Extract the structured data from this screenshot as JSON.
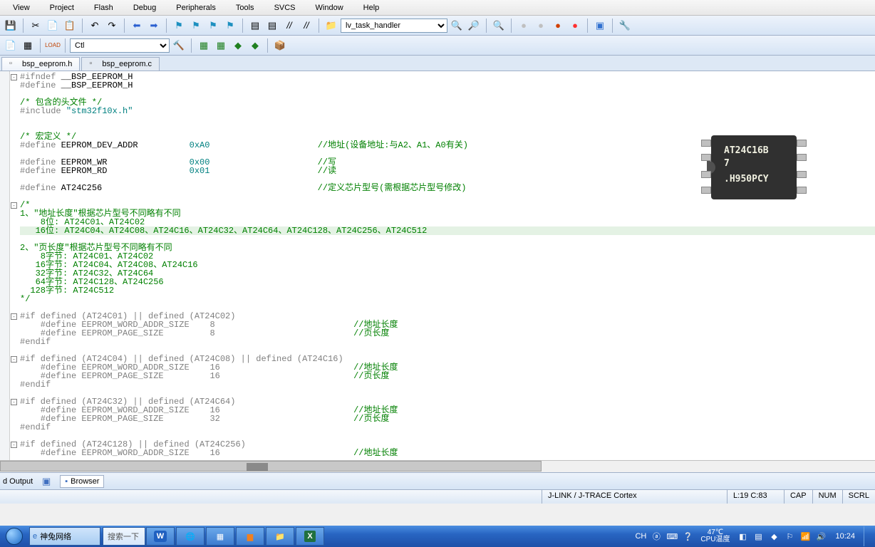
{
  "menu": [
    "View",
    "Project",
    "Flash",
    "Debug",
    "Peripherals",
    "Tools",
    "SVCS",
    "Window",
    "Help"
  ],
  "toolbar1_combo": "lv_task_handler",
  "toolbar2_combo": "Ctl",
  "tabs": [
    {
      "label": "bsp_eeprom.h",
      "active": true
    },
    {
      "label": "bsp_eeprom.c",
      "active": false
    }
  ],
  "code": {
    "l1a": "#ifndef",
    "l1b": " __BSP_EEPROM_H",
    "l2a": "#define",
    "l2b": " __BSP_EEPROM_H",
    "l4": "/* 包含的头文件 */",
    "l5a": "#include ",
    "l5b": "\"stm32f10x.h\"",
    "l8": "/* 宏定义 */",
    "l9a": "#define ",
    "l9b": "EEPROM_DEV_ADDR",
    "l9c": "          0xA0",
    "l9cmt": "                     //地址(设备地址:与A2、A1、A0有关)",
    "l11a": "#define ",
    "l11b": "EEPROM_WR",
    "l11c": "                0x00",
    "l11cmt": "                     //写",
    "l12a": "#define ",
    "l12b": "EEPROM_RD",
    "l12c": "                0x01",
    "l12cmt": "                     //读",
    "l14a": "#define ",
    "l14b": "AT24C256",
    "l14cmt": "                                          //定义芯片型号(需根据芯片型号修改)",
    "blk": [
      "/*",
      "1、\"地址长度\"根据芯片型号不同略有不同",
      "    8位: AT24C01、AT24C02",
      "   16位: AT24C04、AT24C08、AT24C16、AT24C32、AT24C64、AT24C128、AT24C256、AT24C512",
      "",
      "2、\"页长度\"根据芯片型号不同略有不同",
      "    8字节: AT24C01、AT24C02",
      "   16字节: AT24C04、AT24C08、AT24C16",
      "   32字节: AT24C32、AT24C64",
      "   64字节: AT24C128、AT24C256",
      "  128字节: AT24C512",
      "*/"
    ],
    "if1": "#if defined (AT24C01) || defined (AT24C02)",
    "if1d1": "    #define EEPROM_WORD_ADDR_SIZE    8",
    "if1c1": "                           //地址长度",
    "if1d2": "    #define EEPROM_PAGE_SIZE         8",
    "if1c2": "                           //页长度",
    "endif": "#endif",
    "if2": "#if defined (AT24C04) || defined (AT24C08) || defined (AT24C16)",
    "if2d1": "    #define EEPROM_WORD_ADDR_SIZE    16",
    "if2c1": "                          //地址长度",
    "if2d2": "    #define EEPROM_PAGE_SIZE         16",
    "if2c2": "                          //页长度",
    "if3": "#if defined (AT24C32) || defined (AT24C64)",
    "if3d1": "    #define EEPROM_WORD_ADDR_SIZE    16",
    "if3c1": "                          //地址长度",
    "if3d2": "    #define EEPROM_PAGE_SIZE         32",
    "if3c2": "                          //页长度",
    "if4": "#if defined (AT24C128) || defined (AT24C256)",
    "if4d1": "    #define EEPROM_WORD_ADDR_SIZE    16",
    "if4c1": "                          //地址长度"
  },
  "chip": {
    "line1": "AT24C16B",
    "line2": "7",
    "line3": ".H950PCY"
  },
  "bottomtabs": {
    "output": "d Output",
    "browser": "Browser"
  },
  "status": {
    "debugger": "J-LINK / J-TRACE Cortex",
    "pos": "L:19 C:83",
    "cap": "CAP",
    "num": "NUM",
    "scrl": "SCRL"
  },
  "taskbar": {
    "app1": "神兔网络",
    "search": "搜索一下",
    "ime": "CH",
    "imeico": "ⓐ",
    "temp": "47℃",
    "templabel": "CPU温度",
    "clock": "10:24"
  }
}
